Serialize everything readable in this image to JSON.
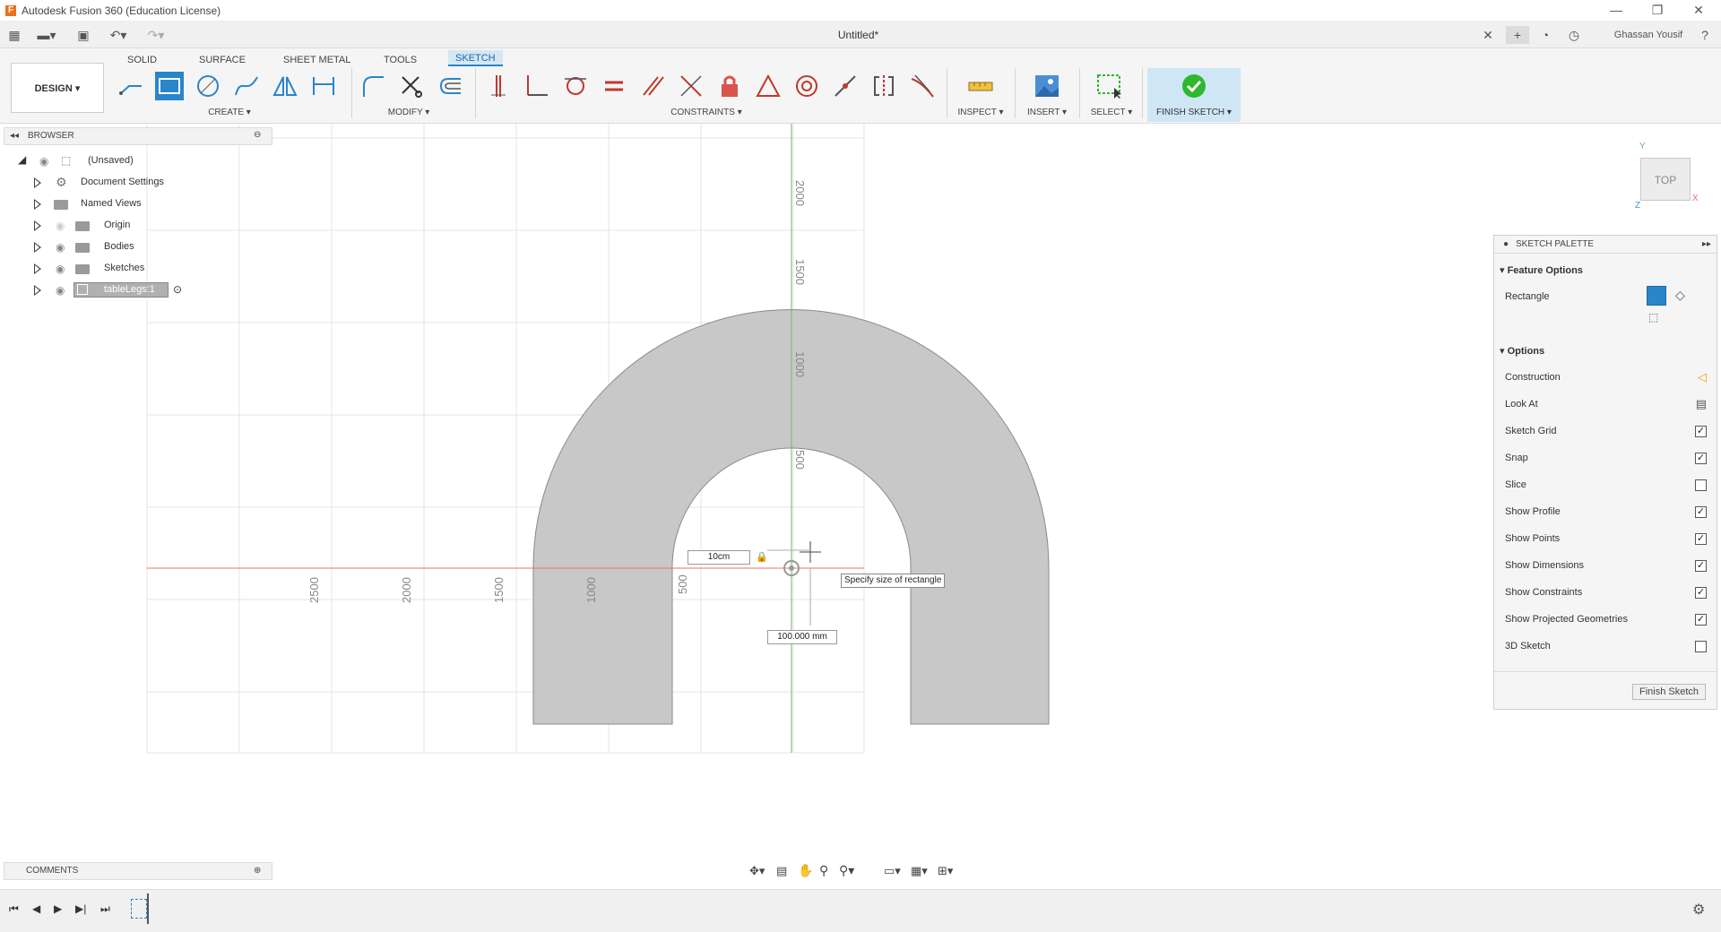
{
  "app": {
    "title": "Autodesk Fusion 360 (Education License)",
    "document_title": "Untitled*",
    "user": "Ghassan Yousif",
    "logo_letter": "F"
  },
  "ribbon": {
    "tabs": [
      "SOLID",
      "SURFACE",
      "SHEET METAL",
      "TOOLS",
      "SKETCH"
    ],
    "active_tab": "SKETCH",
    "workspace": "DESIGN ▾",
    "groups": {
      "create": "CREATE ▾",
      "modify": "MODIFY ▾",
      "constraints": "CONSTRAINTS ▾",
      "inspect": "INSPECT ▾",
      "insert": "INSERT ▾",
      "select": "SELECT ▾",
      "finish": "FINISH SKETCH ▾"
    }
  },
  "browser": {
    "header": "BROWSER",
    "root": "(Unsaved)",
    "items": [
      {
        "label": "Document Settings",
        "icon": "gear-icon"
      },
      {
        "label": "Named Views",
        "icon": "folder-icon"
      },
      {
        "label": "Origin",
        "icon": "folder-icon"
      },
      {
        "label": "Bodies",
        "icon": "folder-icon"
      },
      {
        "label": "Sketches",
        "icon": "folder-icon"
      },
      {
        "label": "tableLegs:1",
        "icon": "component-icon"
      }
    ]
  },
  "canvas": {
    "axis_labels_y": [
      "2000",
      "1500",
      "1000",
      "500"
    ],
    "axis_labels_x": [
      "2500",
      "2000",
      "1500",
      "1000",
      "500"
    ],
    "dim_input_1": "10cm",
    "dim_input_2": "100.000 mm",
    "tooltip": "Specify size of rectangle"
  },
  "viewcube": {
    "face": "TOP",
    "x": "X",
    "y": "Y",
    "z": "Z"
  },
  "palette": {
    "header": "SKETCH PALETTE",
    "feature_options": "Feature Options",
    "rectangle": "Rectangle",
    "options": "Options",
    "rows": [
      {
        "label": "Construction",
        "type": "icon"
      },
      {
        "label": "Look At",
        "type": "icon"
      },
      {
        "label": "Sketch Grid",
        "checked": true
      },
      {
        "label": "Snap",
        "checked": true
      },
      {
        "label": "Slice",
        "checked": false
      },
      {
        "label": "Show Profile",
        "checked": true
      },
      {
        "label": "Show Points",
        "checked": true
      },
      {
        "label": "Show Dimensions",
        "checked": true
      },
      {
        "label": "Show Constraints",
        "checked": true
      },
      {
        "label": "Show Projected Geometries",
        "checked": true
      },
      {
        "label": "3D Sketch",
        "checked": false
      }
    ],
    "finish_button": "Finish Sketch"
  },
  "comments": {
    "header": "COMMENTS"
  },
  "colors": {
    "accent": "#2a85c9",
    "x_axis": "#e57373",
    "y_axis": "#66bb6a",
    "profile_fill": "#c8c8c8",
    "finish_check": "#2eb82e"
  }
}
